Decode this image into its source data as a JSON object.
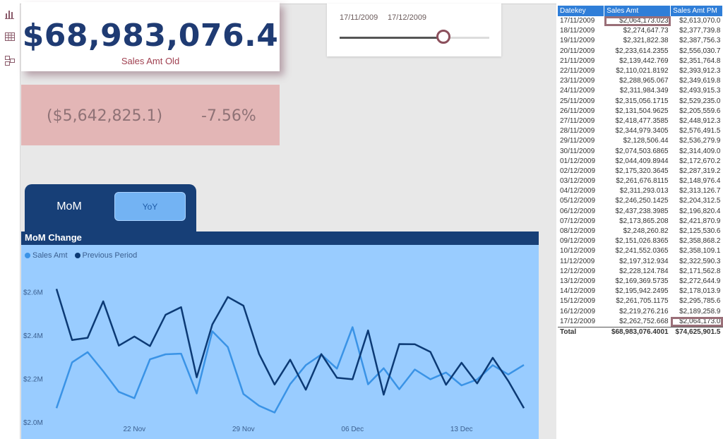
{
  "kpi": {
    "value": "$68,983,076.4",
    "label": "Sales Amt Old"
  },
  "diff": {
    "absolute": "($5,642,825.1)",
    "percent": "-7.56%"
  },
  "slicer": {
    "start_date": "17/11/2009",
    "end_date": "17/12/2009",
    "position": 0.7
  },
  "tabs": {
    "mom": "MoM",
    "yoy": "YoY"
  },
  "chart": {
    "title": "MoM Change",
    "legend": [
      "Sales Amt",
      "Previous Period"
    ],
    "colors": {
      "sales": "#3a93e6",
      "previous": "#0c3a75",
      "background": "#99ccff"
    }
  },
  "chart_data": {
    "type": "line",
    "x": [
      "17 Nov",
      "18 Nov",
      "19 Nov",
      "20 Nov",
      "21 Nov",
      "22 Nov",
      "23 Nov",
      "24 Nov",
      "25 Nov",
      "26 Nov",
      "27 Nov",
      "28 Nov",
      "29 Nov",
      "30 Nov",
      "01 Dec",
      "02 Dec",
      "03 Dec",
      "04 Dec",
      "05 Dec",
      "06 Dec",
      "07 Dec",
      "08 Dec",
      "09 Dec",
      "10 Dec",
      "11 Dec",
      "12 Dec",
      "13 Dec",
      "14 Dec",
      "15 Dec",
      "16 Dec",
      "17 Dec"
    ],
    "x_ticks": [
      "22 Nov",
      "29 Nov",
      "06 Dec",
      "13 Dec"
    ],
    "series": [
      {
        "name": "Sales Amt",
        "values": [
          2.064,
          2.275,
          2.322,
          2.234,
          2.139,
          2.11,
          2.289,
          2.312,
          2.315,
          2.132,
          2.418,
          2.345,
          2.129,
          2.075,
          2.044,
          2.175,
          2.262,
          2.311,
          2.246,
          2.437,
          2.174,
          2.248,
          2.151,
          2.242,
          2.197,
          2.228,
          2.169,
          2.196,
          2.262,
          2.219,
          2.263
        ]
      },
      {
        "name": "Previous Period",
        "values": [
          2.613,
          2.378,
          2.388,
          2.556,
          2.352,
          2.394,
          2.35,
          2.494,
          2.529,
          2.206,
          2.449,
          2.576,
          2.536,
          2.314,
          2.173,
          2.287,
          2.149,
          2.313,
          2.204,
          2.197,
          2.422,
          2.126,
          2.359,
          2.358,
          2.323,
          2.172,
          2.273,
          2.178,
          2.296,
          2.189,
          2.064
        ]
      }
    ],
    "y_ticks": [
      "$2.0M",
      "$2.2M",
      "$2.4M",
      "$2.6M"
    ],
    "ylim": [
      2.0,
      2.65
    ]
  },
  "table": {
    "headers": [
      "Datekey",
      "Sales Amt",
      "Sales Amt PM"
    ],
    "rows": [
      [
        "17/11/2009",
        "$2,064,173.023",
        "$2,613,070.0"
      ],
      [
        "18/11/2009",
        "$2,274,647.73",
        "$2,377,739.8"
      ],
      [
        "19/11/2009",
        "$2,321,822.38",
        "$2,387,756.3"
      ],
      [
        "20/11/2009",
        "$2,233,614.2355",
        "$2,556,030.7"
      ],
      [
        "21/11/2009",
        "$2,139,442.769",
        "$2,351,764.8"
      ],
      [
        "22/11/2009",
        "$2,110,021.8192",
        "$2,393,912.3"
      ],
      [
        "23/11/2009",
        "$2,288,965.067",
        "$2,349,619.8"
      ],
      [
        "24/11/2009",
        "$2,311,984.349",
        "$2,493,915.3"
      ],
      [
        "25/11/2009",
        "$2,315,056.1715",
        "$2,529,235.0"
      ],
      [
        "26/11/2009",
        "$2,131,504.9625",
        "$2,205,559.6"
      ],
      [
        "27/11/2009",
        "$2,418,477.3585",
        "$2,448,912.3"
      ],
      [
        "28/11/2009",
        "$2,344,979.3405",
        "$2,576,491.5"
      ],
      [
        "29/11/2009",
        "$2,128,506.44",
        "$2,536,279.9"
      ],
      [
        "30/11/2009",
        "$2,074,503.6865",
        "$2,314,409.0"
      ],
      [
        "01/12/2009",
        "$2,044,409.8944",
        "$2,172,670.2"
      ],
      [
        "02/12/2009",
        "$2,175,320.3645",
        "$2,287,319.2"
      ],
      [
        "03/12/2009",
        "$2,261,676.8115",
        "$2,148,976.4"
      ],
      [
        "04/12/2009",
        "$2,311,293.013",
        "$2,313,126.7"
      ],
      [
        "05/12/2009",
        "$2,246,250.1425",
        "$2,204,312.5"
      ],
      [
        "06/12/2009",
        "$2,437,238.3985",
        "$2,196,820.4"
      ],
      [
        "07/12/2009",
        "$2,173,865.208",
        "$2,421,870.9"
      ],
      [
        "08/12/2009",
        "$2,248,260.82",
        "$2,125,530.6"
      ],
      [
        "09/12/2009",
        "$2,151,026.8365",
        "$2,358,868.2"
      ],
      [
        "10/12/2009",
        "$2,241,552.0365",
        "$2,358,109.1"
      ],
      [
        "11/12/2009",
        "$2,197,312.934",
        "$2,322,590.3"
      ],
      [
        "12/12/2009",
        "$2,228,124.784",
        "$2,171,562.8"
      ],
      [
        "13/12/2009",
        "$2,169,369.5735",
        "$2,272,644.9"
      ],
      [
        "14/12/2009",
        "$2,195,942.2495",
        "$2,178,013.9"
      ],
      [
        "15/12/2009",
        "$2,261,705.1175",
        "$2,295,785.6"
      ],
      [
        "16/12/2009",
        "$2,219,276.216",
        "$2,189,258.9"
      ],
      [
        "17/12/2009",
        "$2,262,752.668",
        "$2,064,173.0"
      ]
    ],
    "total": [
      "Total",
      "$68,983,076.4001",
      "$74,625,901.5"
    ]
  }
}
